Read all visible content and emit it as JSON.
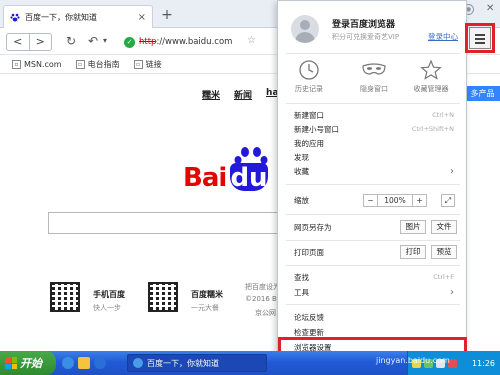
{
  "tab": {
    "title": "百度一下，你就知道",
    "close": "×",
    "new_tab": "+"
  },
  "navbar": {
    "back": "<",
    "forward": ">",
    "url_protocol": "http",
    "url_rest": "://www.baidu.com"
  },
  "bookmarks": [
    {
      "icon": "page-icon",
      "label": "MSN.com"
    },
    {
      "icon": "page-icon",
      "label": "电台指南"
    },
    {
      "icon": "page-icon",
      "label": "链接"
    }
  ],
  "page": {
    "top_links": [
      "糯米",
      "新闻",
      "hao"
    ],
    "more_products": "多产品",
    "logo": {
      "bai": "Bai",
      "du": "du"
    },
    "qr_left": {
      "title": "手机百度",
      "subtitle": "快人一步"
    },
    "qr_right": {
      "title": "百度糯米",
      "subtitle": "一元大餐"
    },
    "footer": [
      "把百度设为",
      "©2016 Bai",
      "京公网"
    ]
  },
  "menu": {
    "login_title": "登录百度浏览器",
    "login_subtitle": "积分可兑换爱奇艺VIP",
    "sync_link": "登录中心",
    "big_icons": [
      {
        "icon": "clock-icon",
        "label": "历史记录"
      },
      {
        "icon": "mask-icon",
        "label": "隐身窗口"
      },
      {
        "icon": "star-icon",
        "label": "收藏管理器"
      }
    ],
    "items_a": [
      {
        "label": "新建窗口",
        "shortcut": "Ctrl+N"
      },
      {
        "label": "新建小号窗口",
        "shortcut": "Ctrl+Shift+N"
      },
      {
        "label": "我的应用",
        "shortcut": ""
      },
      {
        "label": "发现",
        "shortcut": ""
      },
      {
        "label": "收藏",
        "shortcut": "",
        "arrow": "›"
      }
    ],
    "zoom": {
      "label": "缩放",
      "minus": "−",
      "value": "100%",
      "plus": "+",
      "full": "⤢"
    },
    "save": {
      "label": "网页另存为",
      "btn1": "图片",
      "btn2": "文件"
    },
    "print": {
      "label": "打印页面",
      "btn1": "打印",
      "btn2": "预览"
    },
    "find": {
      "label": "查找",
      "shortcut": "Ctrl+F"
    },
    "tools": {
      "label": "工具",
      "arrow": "›"
    },
    "items_b": [
      {
        "label": "论坛反馈"
      },
      {
        "label": "检查更新"
      },
      {
        "label": "浏览器设置"
      }
    ]
  },
  "taskbar": {
    "start": "开始",
    "task_label": "百度一下，你就知道",
    "clock": "11:26"
  },
  "watermark": "jingyan.baidu.com",
  "colors": {
    "highlight": "#e0202a",
    "accent": "#3385ff",
    "logo_red": "#e10602",
    "logo_blue": "#2319dc"
  }
}
